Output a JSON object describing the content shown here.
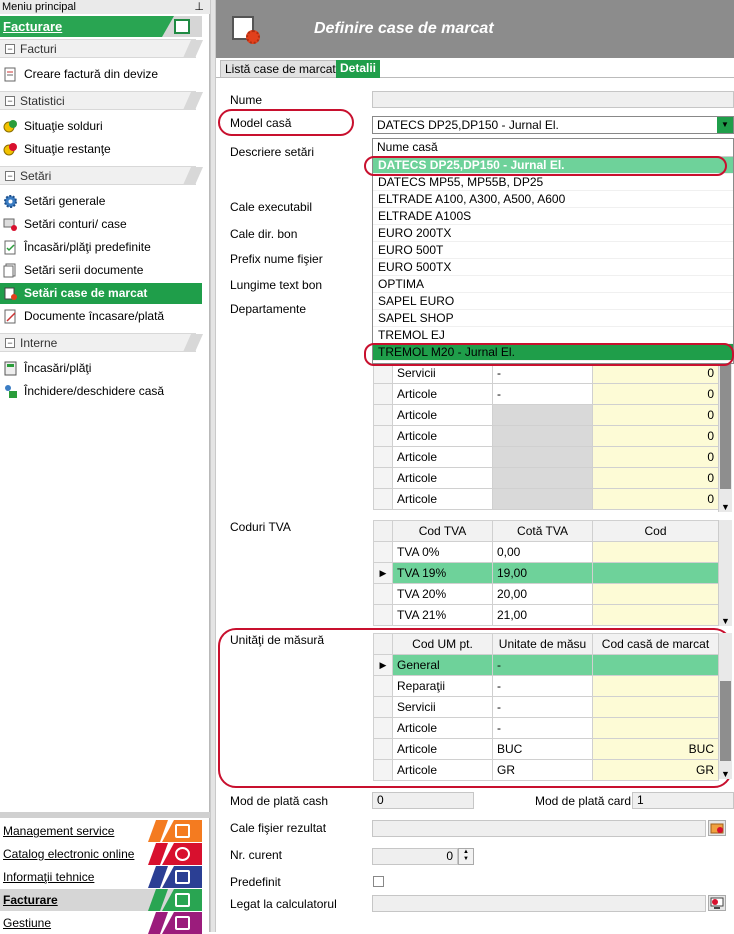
{
  "left_menu": {
    "header": "Meniu principal",
    "group_title": "Facturare",
    "sections": [
      {
        "label": "Facturi",
        "items": [
          "Creare factură din devize"
        ]
      },
      {
        "label": "Statistici",
        "items": [
          "Situaţie solduri",
          "Situaţie restanţe"
        ]
      },
      {
        "label": "Setări",
        "items": [
          "Setări generale",
          "Setări conturi/ case",
          "Încasări/plăţi predefinite",
          "Setări serii documente",
          "Setări case de marcat",
          "Documente încasare/plată"
        ]
      },
      {
        "label": "Interne",
        "items": [
          "Încasări/plăţi",
          "Închidere/deschidere casă"
        ]
      }
    ],
    "bottom_buttons": [
      {
        "label": "Management service",
        "color": "#f47b20"
      },
      {
        "label": "Catalog electronic online",
        "color": "#d8102e"
      },
      {
        "label": "Informaţii tehnice",
        "color": "#2b3f94"
      },
      {
        "label": "Facturare",
        "color": "#29a552"
      },
      {
        "label": "Gestiune",
        "color": "#9b1c7c"
      }
    ]
  },
  "title": "Definire case de marcat",
  "tabs": [
    "Listă case de marcat",
    "Detalii"
  ],
  "form": {
    "nume_label": "Nume",
    "model_label": "Model casă",
    "model_value": "DATECS DP25,DP150 - Jurnal El.",
    "descriere_label": "Descriere setări",
    "cale_exec_label": "Cale executabil",
    "cale_dir_label": "Cale dir. bon",
    "prefix_label": "Prefix nume fişier",
    "lungime_label": "Lungime text bon",
    "departamente_label": "Departamente",
    "coduri_tva_label": "Coduri TVA",
    "um_label": "Unităţi de măsură",
    "cash_label": "Mod de plată cash",
    "cash_value": "0",
    "card_label": "Mod de plată card",
    "card_value": "1",
    "cale_fisier_label": "Cale fişier rezultat",
    "nr_curent_label": "Nr. curent",
    "nr_curent_value": "0",
    "predefinit_label": "Predefinit",
    "legat_label": "Legat la calculatorul"
  },
  "dropdown": {
    "header": "Nume casă",
    "options": [
      "DATECS DP25,DP150 - Jurnal El.",
      "DATECS MP55, MP55B, DP25",
      "ELTRADE A100, A300, A500, A600",
      "ELTRADE A100S",
      "EURO 200TX",
      "EURO 500T",
      "EURO 500TX",
      "OPTIMA",
      "SAPEL EURO",
      "SAPEL SHOP",
      "TREMOL EJ",
      "TREMOL M20 - Jurnal El."
    ]
  },
  "departamente_rows": [
    {
      "a": "Servicii",
      "b": "-",
      "c": "0"
    },
    {
      "a": "Articole",
      "b": "-",
      "c": "0"
    },
    {
      "a": "Articole",
      "b": "",
      "c": "0"
    },
    {
      "a": "Articole",
      "b": "",
      "c": "0"
    },
    {
      "a": "Articole",
      "b": "",
      "c": "0"
    },
    {
      "a": "Articole",
      "b": "",
      "c": "0"
    },
    {
      "a": "Articole",
      "b": "",
      "c": "0"
    }
  ],
  "tva": {
    "headers": [
      "Cod TVA",
      "Cotă TVA",
      "Cod"
    ],
    "rows": [
      {
        "cod": "TVA 0%",
        "cota": "0,00",
        "c": ""
      },
      {
        "cod": "TVA 19%",
        "cota": "19,00",
        "c": ""
      },
      {
        "cod": "TVA 20%",
        "cota": "20,00",
        "c": ""
      },
      {
        "cod": "TVA 21%",
        "cota": "21,00",
        "c": ""
      }
    ]
  },
  "um": {
    "headers": [
      "Cod UM pt.",
      "Unitate de măsu",
      "Cod casă de marcat"
    ],
    "rows": [
      {
        "cod": "General",
        "unit": "-",
        "c": ""
      },
      {
        "cod": "Reparaţii",
        "unit": "-",
        "c": ""
      },
      {
        "cod": "Servicii",
        "unit": "-",
        "c": ""
      },
      {
        "cod": "Articole",
        "unit": "-",
        "c": ""
      },
      {
        "cod": "Articole",
        "unit": "BUC",
        "c": "BUC"
      },
      {
        "cod": "Articole",
        "unit": "GR",
        "c": "GR"
      }
    ]
  }
}
